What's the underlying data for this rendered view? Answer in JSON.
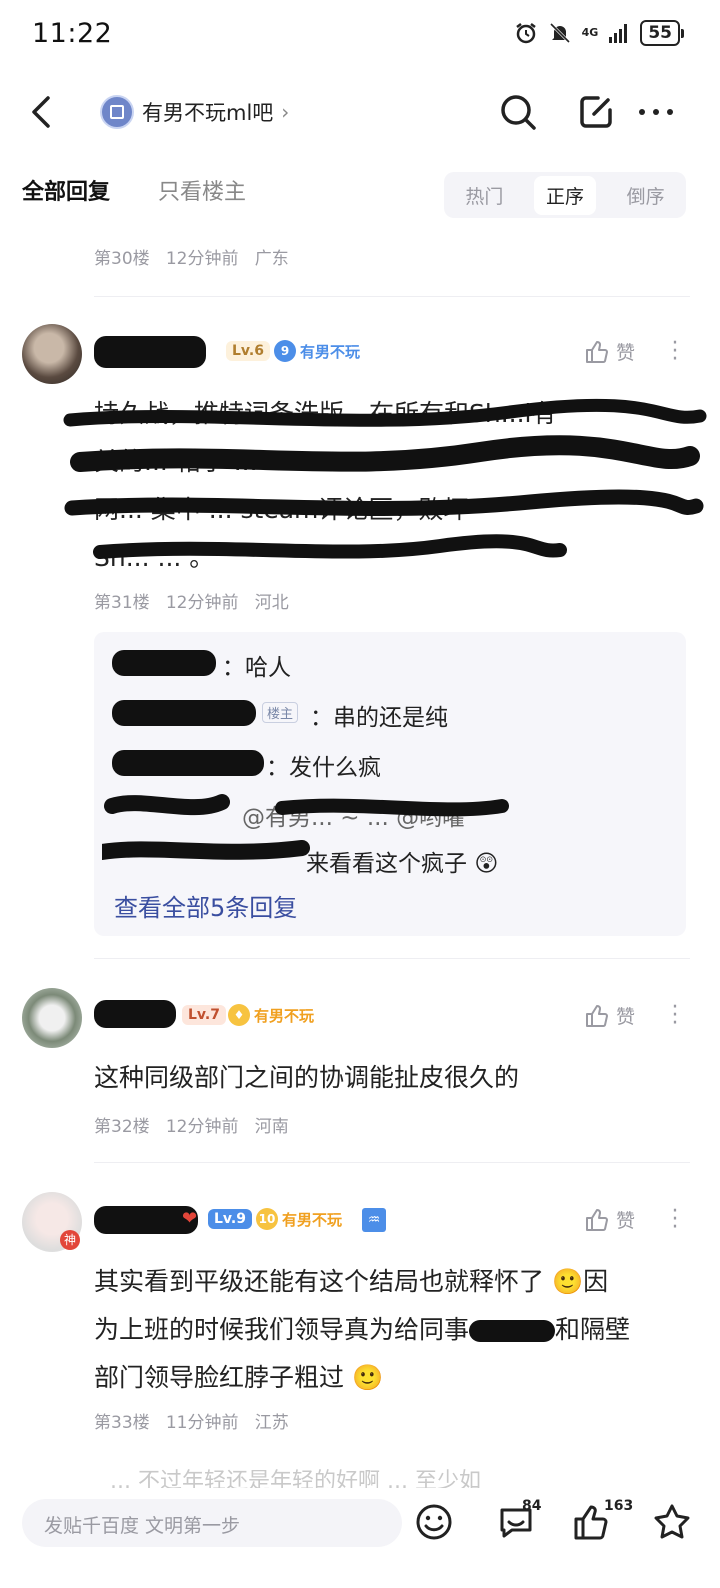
{
  "status_bar": {
    "time": "11:22",
    "network": "4G",
    "battery": "55"
  },
  "nav": {
    "forum_name": "有男不玩ml吧",
    "chevron": "›"
  },
  "tabs": {
    "all_replies": "全部回复",
    "op_only": "只看楼主"
  },
  "sort": {
    "hot": "热门",
    "asc": "正序",
    "desc": "倒序",
    "active": "正序"
  },
  "floor30_meta": {
    "floor": "第30楼",
    "time": "12分钟前",
    "region": "广东"
  },
  "posts": [
    {
      "level": "Lv.6",
      "fan_badge_num": "9",
      "fan_badge_label": "有男不玩",
      "like_label": "赞",
      "lines": [
        "持久战，推特词条洗版，在所有和Sh...l有",
        "关的... 帖子 ...",
        "网... 集中 ... steam评论区，败坏",
        "Sh... ... 。"
      ],
      "floor": "第31楼",
      "time": "12分钟前",
      "region": "河北",
      "replies": [
        {
          "text": "哈人"
        },
        {
          "host_tag": "楼主",
          "text": "串的还是纯"
        },
        {
          "text": "发什么疯"
        },
        {
          "text": "@有男... ~ ... @哟嚯"
        },
        {
          "text": "来看看这个疯子"
        }
      ],
      "see_all": "查看全部5条回复"
    },
    {
      "level": "Lv.7",
      "fan_badge_label": "有男不玩",
      "like_label": "赞",
      "lines": [
        "这种同级部门之间的协调能扯皮很久的"
      ],
      "floor": "第32楼",
      "time": "12分钟前",
      "region": "河南"
    },
    {
      "level": "Lv.9",
      "fan_badge_num": "10",
      "fan_badge_label": "有男不玩",
      "like_label": "赞",
      "avatar_badge": "神",
      "lines": [
        "其实看到平级还能有这个结局也就释怀了",
        "为上班的时候我们领导真为给同事",
        "部门领导脸红脖子粗过"
      ],
      "line_tails": [
        "因",
        "和隔壁"
      ],
      "floor": "第33楼",
      "time": "11分钟前",
      "region": "江苏"
    }
  ],
  "faded_next": "... 不过年轻还是年轻的好啊 ... 至少如",
  "bottom_bar": {
    "placeholder": "发贴千百度 文明第一步",
    "comment_count": "84",
    "like_count": "163"
  },
  "colors": {
    "link": "#3a4ea0",
    "fan_orange": "#f0a020",
    "fan_blue": "#4c8ee8",
    "meta_gray": "#9a9aa2"
  }
}
